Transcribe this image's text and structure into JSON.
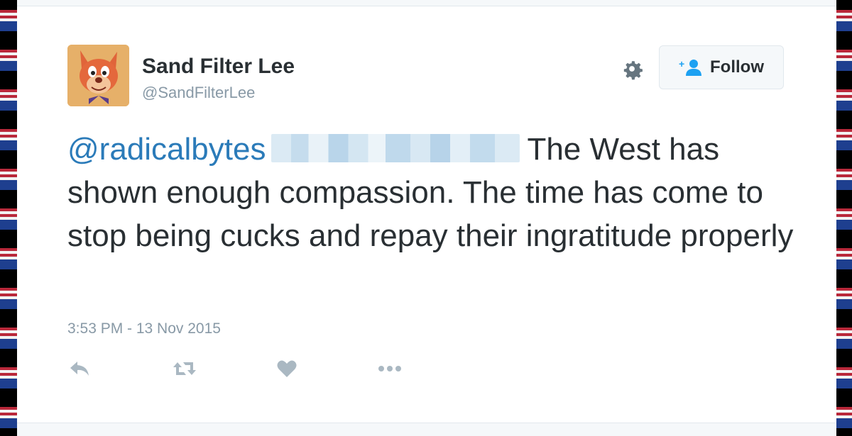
{
  "user": {
    "name": "Sand Filter Lee",
    "handle": "@SandFilterLee"
  },
  "follow_button": {
    "label": "Follow"
  },
  "tweet": {
    "mention": "@radicalbytes",
    "text": "The West has shown enough compassion. The time has come to stop being cucks and repay their ingratitude properly",
    "timestamp": "3:53 PM - 13 Nov 2015"
  },
  "icons": {
    "gear": "gear-icon",
    "follow": "add-user-icon",
    "reply": "reply-icon",
    "retweet": "retweet-icon",
    "like": "heart-icon",
    "more": "more-icon"
  },
  "colors": {
    "link": "#2b7bb9",
    "text": "#292f33",
    "muted": "#8899a6",
    "icon": "#aab8c2"
  }
}
